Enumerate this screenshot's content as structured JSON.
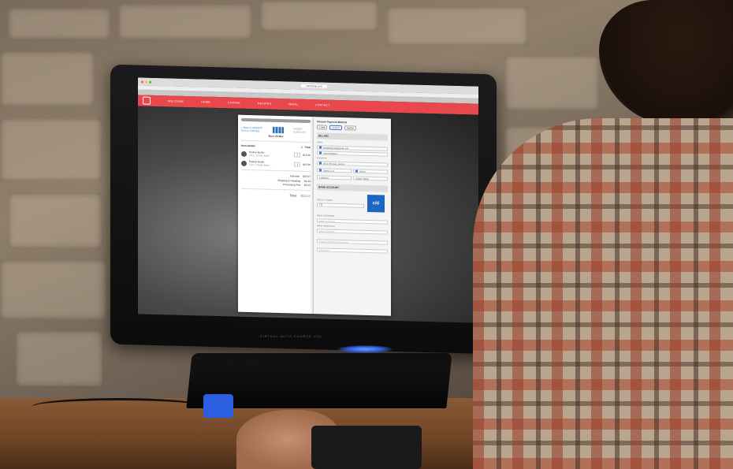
{
  "browser": {
    "url": "ceresshop.com",
    "nav_items": [
      "WELCOME",
      "HOME",
      "COFFEE",
      "RECIPES",
      "MENU",
      "CONTACT"
    ]
  },
  "order": {
    "back_link": "< Back to ABSENT-SOCO COFFEE",
    "title": "Your Order",
    "reviewer_hint": "ORDER SUMMARY",
    "col_item": "Item Details",
    "col_qty": "#",
    "col_total": "Total",
    "items": [
      {
        "name": "Peanut Butter",
        "sub": "12oz, Whole Bean",
        "qty": "1",
        "price": "$15.00"
      },
      {
        "name": "Peanut Butter",
        "sub": "12oz, Whole Bean",
        "qty": "1",
        "price": "$15.00"
      }
    ],
    "subtotal_label": "Subtotal:",
    "subtotal": "$30.97",
    "shipping_label": "Shipping & Handling:",
    "shipping": "$1.99",
    "processing_label": "Processing Fee:",
    "processing": "$0.25",
    "total_label": "Total",
    "total": "$33.21"
  },
  "payment": {
    "heading": "Choose Payment Method",
    "methods": [
      "Credit",
      "eCheck",
      "PayPal"
    ],
    "billing_head": "BILLING",
    "email_label": "EMAIL",
    "email": "emailaddress@gmail.com",
    "name": "Dana Bingham",
    "address_label": "ADDRESS",
    "street": "4513 Elm Ave, Suite 4",
    "city": "Santa Cruz",
    "zip": "95060",
    "state": "California",
    "country": "United States",
    "bank_head": "BANK ACCOUNT",
    "bank_select_label": "SELECT A BANK",
    "bank_selected": "Citi",
    "bank_logo_text": "citi",
    "username_label": "BANK USERNAME",
    "username_placeholder": "Bank Username",
    "password_label": "BANK PASSWORD",
    "password_placeholder": "Bank Password",
    "phone_placeholder": "Phone Number (xxx-xxx-xxxx)",
    "dob_placeholder": "DOB/SSN"
  },
  "monitor_chin": "VIRTUAL  AUTO  SOURCE  VOL"
}
